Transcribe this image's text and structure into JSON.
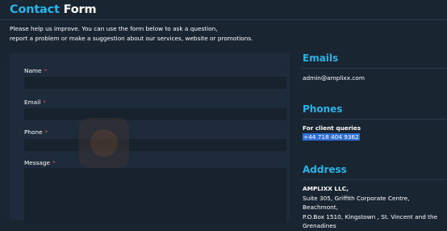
{
  "header": {
    "title_accent": "Contact",
    "title_rest": "Form",
    "intro_line1": "Please help us improve. You can use the form below to ask a question,",
    "intro_line2": "report a problem or make a suggestion about our services, website or promotions."
  },
  "form": {
    "name_label": "Name",
    "email_label": "Email",
    "phone_label": "Phone",
    "message_label": "Message",
    "required_marker": "*"
  },
  "sidebar": {
    "emails_heading": "Emails",
    "email_address": "admin@amplixx.com",
    "phones_heading": "Phones",
    "phone_caption": "For client queries",
    "phone_number": "+44 718 404 9362",
    "address_heading": "Address",
    "company": "AMPLIXX LLC,",
    "address_line1": "Suite 305, Griffith Corporate Centre, Beachmont,",
    "address_line2": "P.O.Box 1510, Kingstown , St. Vincent and the",
    "address_line3": "Grenadines"
  },
  "colors": {
    "background": "#1a2532",
    "accent": "#2ab3e6",
    "required": "#e0524d",
    "selection": "#2f6fd6"
  }
}
